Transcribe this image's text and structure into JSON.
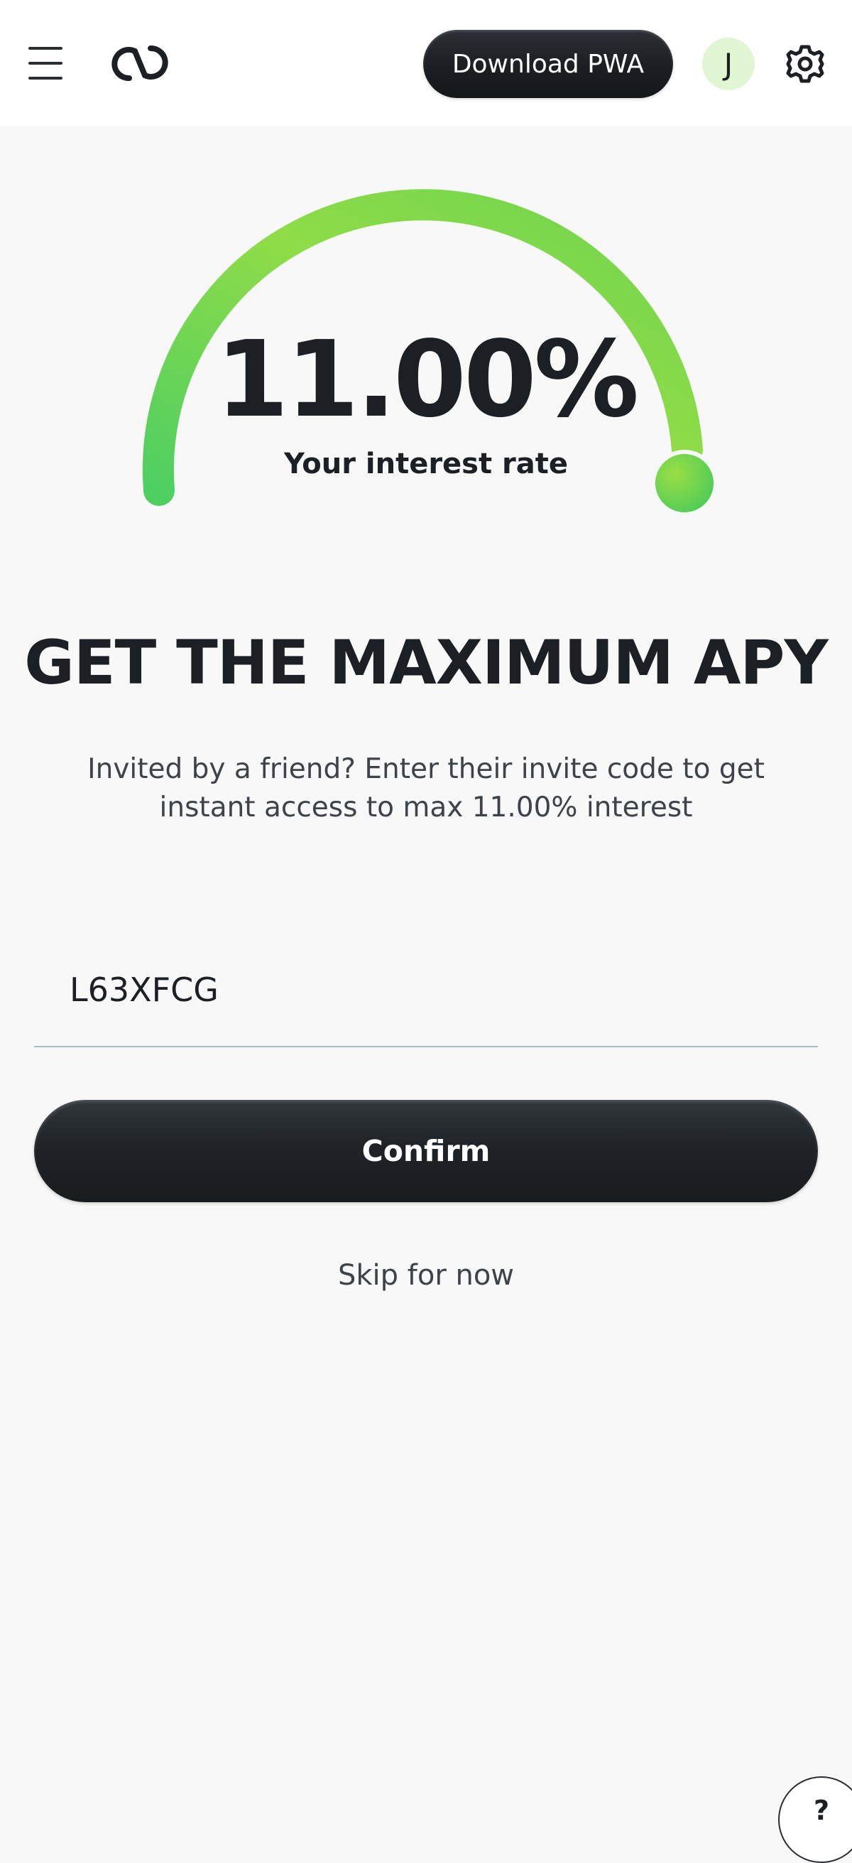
{
  "header": {
    "download_label": "Download PWA",
    "avatar_initial": "J"
  },
  "rate": {
    "value": "11.00%",
    "label": "Your interest rate",
    "gauge_colors": [
      "#4fcf62",
      "#9bde45"
    ]
  },
  "promo": {
    "headline": "GET THE MAXIMUM APY",
    "subtitle": "Invited by a friend? Enter their invite code to get instant access to max 11.00% interest"
  },
  "invite": {
    "code_value": "L63XFCG"
  },
  "actions": {
    "confirm_label": "Confirm",
    "skip_label": "Skip for now"
  },
  "help": {
    "label": "?"
  },
  "icons": {
    "menu": "hamburger-menu-icon",
    "logo": "link-logo-icon",
    "settings": "gear-icon",
    "help": "question-icon"
  }
}
